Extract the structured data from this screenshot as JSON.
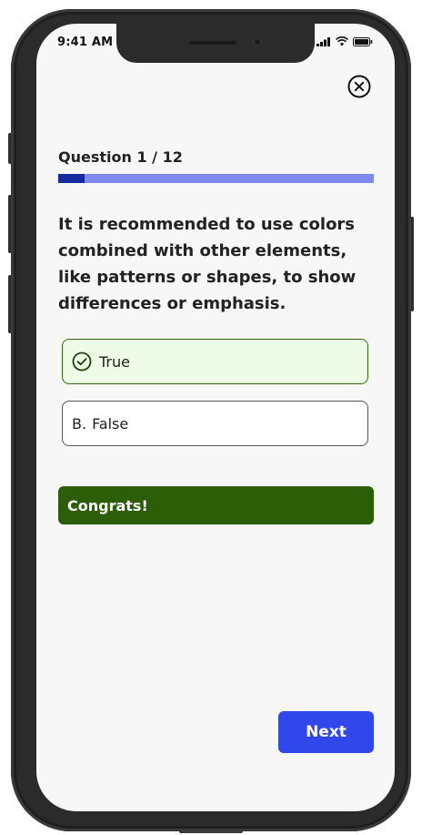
{
  "status_bar": {
    "time": "9:41 AM",
    "icons": [
      "signal-icon",
      "wifi-icon",
      "battery-icon"
    ]
  },
  "header": {
    "close_icon": "close-circle-icon"
  },
  "quiz": {
    "counter": "Question 1 / 12",
    "progress_fraction": 0.0833,
    "question": "It is recommended to use colors combined with other elements, like patterns or shapes, to show differences or emphasis.",
    "answers": [
      {
        "letter": "",
        "label": "True",
        "state": "correct",
        "icon": "check-circle-icon"
      },
      {
        "letter": "B.",
        "label": "False",
        "state": "default"
      }
    ],
    "feedback": "Congrats!",
    "next_label": "Next"
  },
  "colors": {
    "progress_fill": "#142a9e",
    "progress_track": "#7f8aef",
    "correct_bg": "#eefbe6",
    "correct_border": "#2d6a0a",
    "feedback_bg": "#2b5e07",
    "primary_button": "#3047ec"
  }
}
